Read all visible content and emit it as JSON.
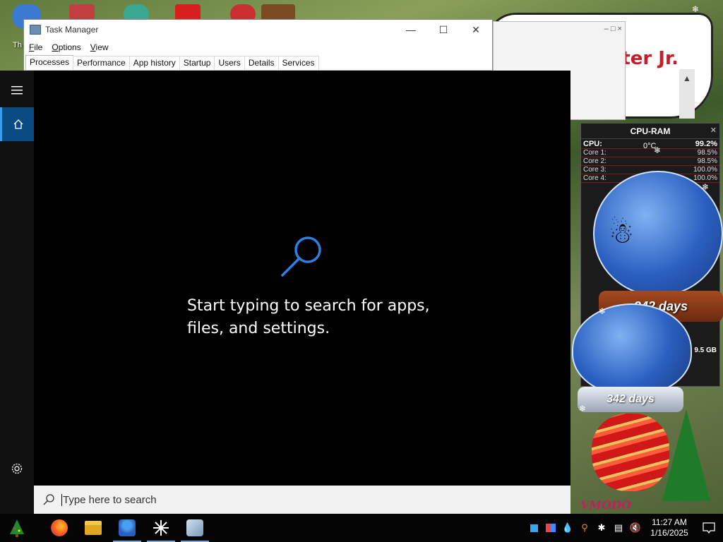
{
  "desktop": {
    "icon_label": "Th",
    "note_text": "arter Jr."
  },
  "task_manager": {
    "title": "Task Manager",
    "window_controls": {
      "minimize": "—",
      "maximize": "☐",
      "close": "✕"
    },
    "menu": [
      "File",
      "Options",
      "View"
    ],
    "tabs": [
      "Processes",
      "Performance",
      "App history",
      "Startup",
      "Users",
      "Details",
      "Services"
    ],
    "active_tab": "Processes"
  },
  "background_window": {
    "controls": "– □ ×",
    "scroll_up": "▲"
  },
  "start": {
    "menu_icon": "hamburger-icon",
    "home_icon": "home-icon",
    "settings_icon": "gear-icon",
    "hint_line1": "Start typing to search for apps,",
    "hint_line2": "files, and settings.",
    "search_placeholder": "Type here to search"
  },
  "cpu_ram_widget": {
    "title": "CPU-RAM",
    "close": "✕",
    "temperature": "0°C",
    "rows": [
      {
        "label": "CPU:",
        "value": "99.2%"
      },
      {
        "label": "Core 1:",
        "value": "98.5%"
      },
      {
        "label": "Core 2:",
        "value": "98.5%"
      },
      {
        "label": "Core 3:",
        "value": "100.0%"
      },
      {
        "label": "Core 4:",
        "value": "100.0%"
      }
    ],
    "ram_value": "9.5 GB"
  },
  "snow_globes": {
    "days_label_1": "342 days",
    "days_label_2": "342 days"
  },
  "taskbar": {
    "apps": [
      "firefox-icon",
      "file-explorer-icon",
      "people-app-icon",
      "sparkle-app-icon",
      "photo-app-icon"
    ],
    "tray_icons": [
      "app-square-icon",
      "network-app-icon",
      "droplet-icon",
      "search-tray-icon",
      "sparkle-tray-icon",
      "network-icon",
      "volume-muted-icon"
    ],
    "clock_time": "11:27 AM",
    "clock_date": "1/16/2025",
    "notification_icon": "notification-icon"
  },
  "colors": {
    "accent_blue": "#0078d7",
    "taskbar_bg": "#050505",
    "search_bg": "#000000",
    "widget_red": "#7a1a1a"
  }
}
